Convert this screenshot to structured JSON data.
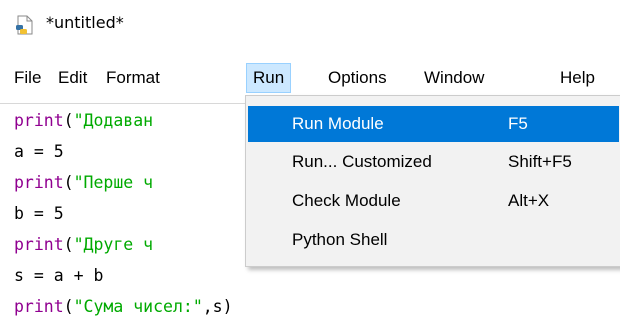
{
  "window": {
    "title": "*untitled*"
  },
  "menubar": [
    "File",
    "Edit",
    "Format",
    "Run",
    "Options",
    "Window",
    "Help"
  ],
  "run_menu": [
    {
      "label": "Run Module",
      "shortcut": "F5"
    },
    {
      "label": "Run... Customized",
      "shortcut": "Shift+F5"
    },
    {
      "label": "Check Module",
      "shortcut": "Alt+X"
    },
    {
      "label": "Python Shell",
      "shortcut": ""
    }
  ],
  "code": {
    "line1": {
      "fn": "print",
      "open": "(",
      "str": "\"Додаван"
    },
    "line2": {
      "text": "a = 5"
    },
    "line3": {
      "fn": "print",
      "open": "(",
      "str": "\"Перше ч"
    },
    "line4": {
      "text": "b = 5"
    },
    "line5": {
      "fn": "print",
      "open": "(",
      "str": "\"Друге ч"
    },
    "line6": {
      "text": "s = a + b"
    },
    "line7": {
      "fn": "print",
      "open": "(",
      "str": "\"Сума чисел:\"",
      "rest": ",s)"
    }
  },
  "colors": {
    "builtin": "#900090",
    "string": "#00aa00",
    "menu_highlight": "#0078d7",
    "menubar_active": "#cce8ff"
  }
}
